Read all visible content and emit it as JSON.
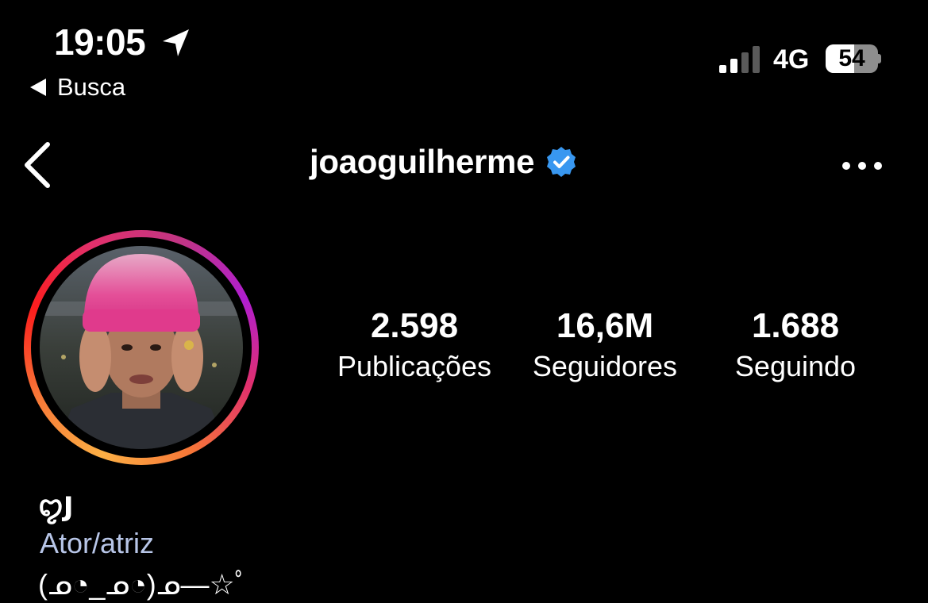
{
  "status_bar": {
    "time": "19:05",
    "back_app": "Busca",
    "network": "4G",
    "battery_percent": 54,
    "battery_label": "54",
    "signal_bars_active": 2,
    "signal_bars_total": 4
  },
  "header": {
    "username": "joaoguilherme",
    "verified": true,
    "verified_color": "#3897f0",
    "back_icon": "chevron-left-icon",
    "more_icon": "ellipsis-icon"
  },
  "profile": {
    "story_ring_colors": [
      "#fcaf45",
      "#f77737",
      "#e1306c",
      "#c13584",
      "#b01ed0"
    ],
    "stats": [
      {
        "value": "2.598",
        "label": "Publicações"
      },
      {
        "value": "16,6M",
        "label": "Seguidores"
      },
      {
        "value": "1.688",
        "label": "Seguindo"
      }
    ],
    "name": "ꨄ︎𝗝",
    "category": "Ator/atriz",
    "bio_line": "(ᓄ◔_ᓄ◔)ᓄ—☆ﾟ"
  }
}
